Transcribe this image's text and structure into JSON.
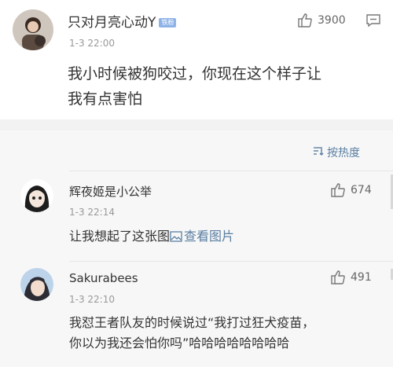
{
  "main_comment": {
    "user_name": "只对月亮心动Y",
    "badge": "铁粉",
    "time": "1-3 22:00",
    "likes": "3900",
    "text_line1": "我小时候被狗咬过，你现在这个样子让",
    "text_line2": "我有点害怕"
  },
  "sort_label": "按热度",
  "replies": [
    {
      "user_name": "辉夜姬是小公举",
      "time": "1-3 22:14",
      "likes": "674",
      "text": "让我想起了这张图",
      "link_text": "查看图片"
    },
    {
      "user_name": "Sakurabees",
      "time": "1-3 22:10",
      "likes": "491",
      "text_line1": "我怼王者队友的时候说过“我打过狂犬疫苗，",
      "text_line2": "你以为我还会怕你吗”哈哈哈哈哈哈哈哈"
    }
  ],
  "colors": {
    "link": "#5a7fa3",
    "badge": "#8fb3e8",
    "separator": "#f2f2f2",
    "reply_bg": "#f7f7f7"
  }
}
